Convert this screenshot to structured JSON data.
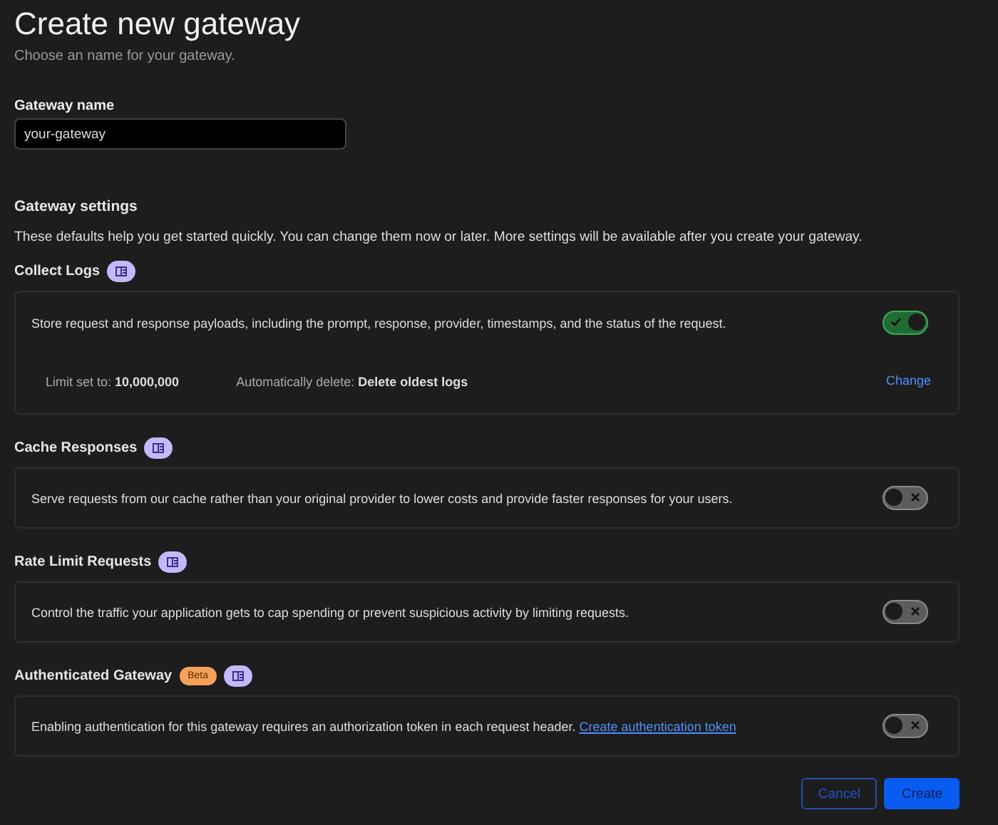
{
  "header": {
    "title": "Create new gateway",
    "subtitle": "Choose an name for your gateway."
  },
  "name_field": {
    "label": "Gateway name",
    "value": "your-gateway"
  },
  "settings": {
    "heading": "Gateway settings",
    "description": "These defaults help you get started quickly. You can change them now or later. More settings will be available after you create your gateway.",
    "sections": [
      {
        "title": "Collect Logs",
        "description": "Store request and response payloads, including the prompt, response, provider, timestamps, and the status of the request.",
        "enabled": true,
        "details": [
          "Limit set to: **10,000,000**",
          "Automatically delete: **Delete oldest logs**"
        ],
        "action": "Change"
      },
      {
        "title": "Cache Responses",
        "description": "Serve requests from our cache rather than your original provider to lower costs and provide faster responses for your users.",
        "enabled": false
      },
      {
        "title": "Rate Limit Requests",
        "description": "Control the traffic your application gets to cap spending or prevent suspicious activity by limiting requests.",
        "enabled": false
      },
      {
        "title": "Authenticated Gateway",
        "badges": [
          "Beta"
        ],
        "description": "Enabling authentication for this gateway requires an authorization token in each request header.",
        "link": "Create authentication token",
        "enabled": false
      }
    ]
  },
  "buttons": [
    {
      "label": "Cancel",
      "kind": "secondary"
    },
    {
      "label": "Create",
      "kind": "primary"
    }
  ]
}
